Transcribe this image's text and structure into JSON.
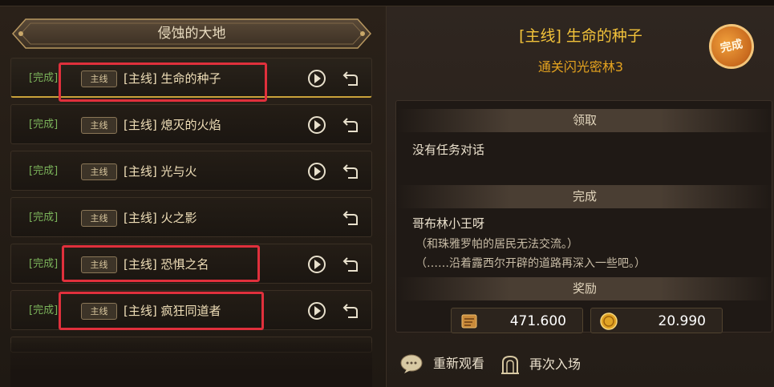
{
  "left": {
    "banner_title": "侵蚀的大地",
    "quests": [
      {
        "status": "[完成]",
        "tag": "主线",
        "name": "[主线] 生命的种子",
        "has_play": true
      },
      {
        "status": "[完成]",
        "tag": "主线",
        "name": "[主线] 熄灭的火焰",
        "has_play": true
      },
      {
        "status": "[完成]",
        "tag": "主线",
        "name": "[主线] 光与火",
        "has_play": true
      },
      {
        "status": "[完成]",
        "tag": "主线",
        "name": "[主线] 火之影",
        "has_play": false
      },
      {
        "status": "[完成]",
        "tag": "主线",
        "name": "[主线] 恐惧之名",
        "has_play": true
      },
      {
        "status": "[完成]",
        "tag": "主线",
        "name": "[主线] 疯狂同道者",
        "has_play": true
      }
    ]
  },
  "right": {
    "title": "[主线] 生命的种子",
    "subtitle": "通关闪光密林3",
    "stamp_text": "完成",
    "sections": {
      "receive": {
        "header": "领取",
        "text": "没有任务对话"
      },
      "complete": {
        "header": "完成",
        "speaker": "哥布林小王呀",
        "lines": [
          "（和珠雅罗帕的居民无法交流。）",
          "（……沿着露西尔开辟的道路再深入一些吧。）"
        ]
      },
      "reward": {
        "header": "奖励",
        "items": [
          {
            "icon": "exp-scroll-icon",
            "value": "471.600"
          },
          {
            "icon": "gold-coin-icon",
            "value": "20.990"
          }
        ]
      }
    },
    "actions": {
      "rewatch_label": "重新观看",
      "reenter_label": "再次入场"
    }
  },
  "colors": {
    "accent_gold": "#f2c23a",
    "subtitle_orange": "#e5a31f",
    "status_green": "#7bb35a",
    "highlight_red": "#e0303c"
  }
}
